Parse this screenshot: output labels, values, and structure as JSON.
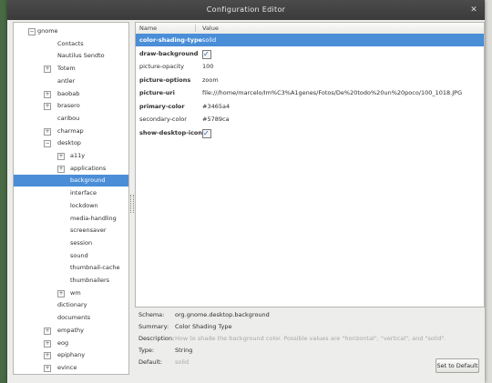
{
  "window": {
    "title": "Configuration Editor"
  },
  "tree": {
    "items": [
      {
        "label": "gnome",
        "expander": "−"
      },
      {
        "label": "Contacts",
        "expander": ""
      },
      {
        "label": "Nautilus Sendto",
        "expander": ""
      },
      {
        "label": "Totem",
        "expander": "+"
      },
      {
        "label": "antler",
        "expander": ""
      },
      {
        "label": "baobab",
        "expander": "+"
      },
      {
        "label": "brasero",
        "expander": "+"
      },
      {
        "label": "caribou",
        "expander": ""
      },
      {
        "label": "charmap",
        "expander": "+"
      },
      {
        "label": "desktop",
        "expander": "−"
      },
      {
        "label": "a11y",
        "expander": "+"
      },
      {
        "label": "applications",
        "expander": "+"
      },
      {
        "label": "background",
        "expander": ""
      },
      {
        "label": "interface",
        "expander": ""
      },
      {
        "label": "lockdown",
        "expander": ""
      },
      {
        "label": "media-handling",
        "expander": ""
      },
      {
        "label": "screensaver",
        "expander": ""
      },
      {
        "label": "session",
        "expander": ""
      },
      {
        "label": "sound",
        "expander": ""
      },
      {
        "label": "thumbnail-cache",
        "expander": ""
      },
      {
        "label": "thumbnailers",
        "expander": ""
      },
      {
        "label": "wm",
        "expander": "+"
      },
      {
        "label": "dictionary",
        "expander": ""
      },
      {
        "label": "documents",
        "expander": ""
      },
      {
        "label": "empathy",
        "expander": "+"
      },
      {
        "label": "eog",
        "expander": "+"
      },
      {
        "label": "epiphany",
        "expander": "+"
      },
      {
        "label": "evince",
        "expander": "+"
      }
    ],
    "selected": "background"
  },
  "values": {
    "columns": {
      "name": "Name",
      "value": "Value"
    },
    "rows": [
      {
        "name": "color-shading-type",
        "value": "solid",
        "bold": true,
        "checkbox": false
      },
      {
        "name": "draw-background",
        "value": "",
        "bold": true,
        "checkbox": true
      },
      {
        "name": "picture-opacity",
        "value": "100",
        "bold": false,
        "checkbox": false
      },
      {
        "name": "picture-options",
        "value": "zoom",
        "bold": true,
        "checkbox": false
      },
      {
        "name": "picture-uri",
        "value": "file:///home/marcelo/Im%C3%A1genes/Fotos/De%20todo%20un%20poco/100_1018.JPG",
        "bold": true,
        "checkbox": false
      },
      {
        "name": "primary-color",
        "value": "#3465a4",
        "bold": true,
        "checkbox": false
      },
      {
        "name": "secondary-color",
        "value": "#5789ca",
        "bold": false,
        "checkbox": false
      },
      {
        "name": "show-desktop-icons",
        "value": "",
        "bold": true,
        "checkbox": true
      }
    ]
  },
  "details": {
    "schema_label": "Schema:",
    "schema": "org.gnome.desktop.background",
    "summary_label": "Summary:",
    "summary": "Color Shading Type",
    "description_label": "Description:",
    "description": "How to shade the background color. Possible values are \"horizontal\", \"vertical\", and \"solid\".",
    "type_label": "Type:",
    "type": "String",
    "default_label": "Default:",
    "default": "solid",
    "reset_button": "Set to Default"
  }
}
